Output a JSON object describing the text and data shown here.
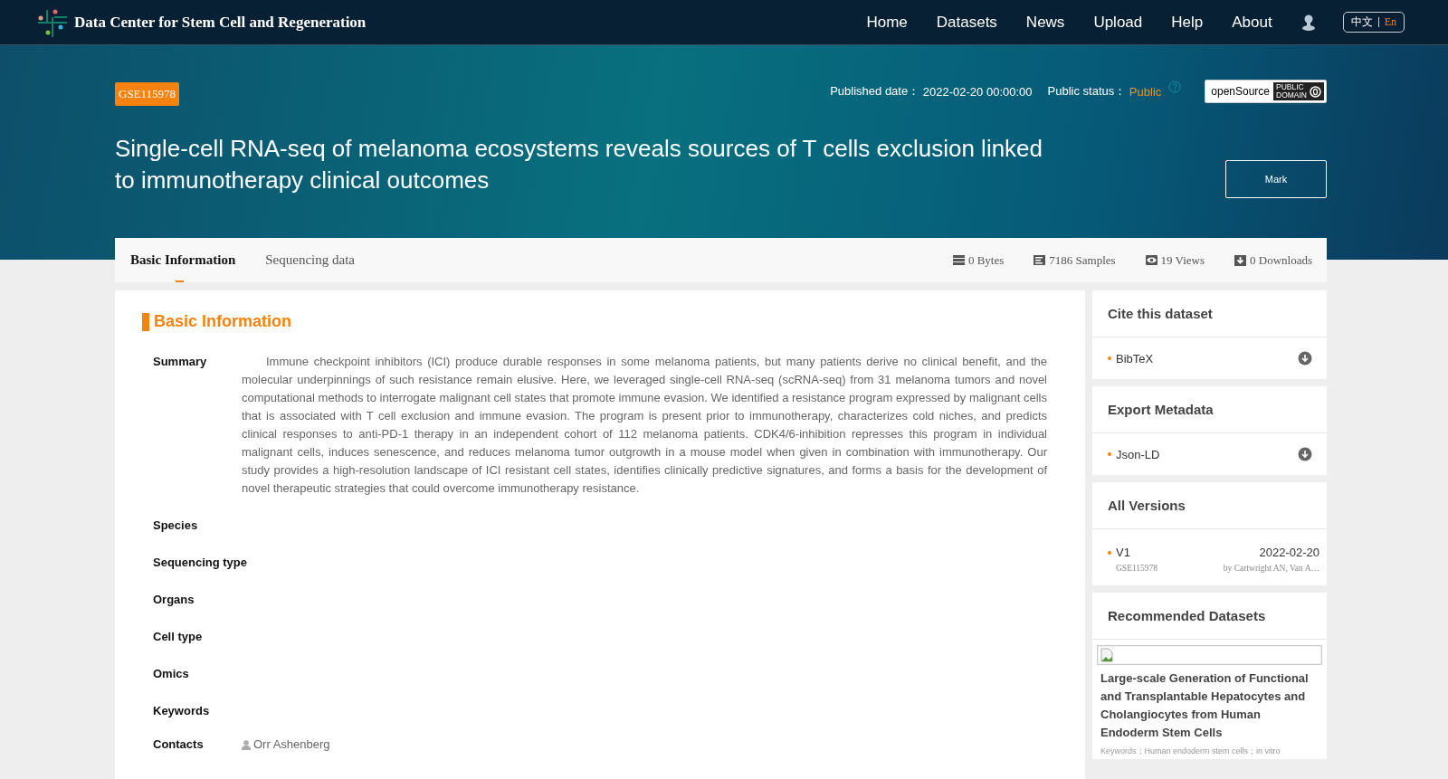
{
  "header": {
    "site_title": "Data Center for Stem Cell and Regeneration",
    "nav": [
      {
        "label": "Home"
      },
      {
        "label": "Datasets"
      },
      {
        "label": "News"
      },
      {
        "label": "Upload"
      },
      {
        "label": "Help"
      },
      {
        "label": "About"
      }
    ],
    "languages": [
      {
        "label": "中文",
        "selected": false
      },
      {
        "label": "En",
        "selected": true
      }
    ]
  },
  "dataset": {
    "accession": "GSE115978",
    "published_label": "Published date：",
    "published_date": "2022-02-20 00:00:00",
    "status_label": "Public status：",
    "status": "Public",
    "license_label": "openSource",
    "license_badge": [
      "PUBLIC",
      "DOMAIN"
    ],
    "title": "Single-cell RNA-seq of melanoma ecosystems reveals sources of T cells exclusion linked to immunotherapy clinical outcomes",
    "mark_button": "Mark"
  },
  "tabs": [
    {
      "label": "Basic Information",
      "selected": true
    },
    {
      "label": "Sequencing data",
      "selected": false
    }
  ],
  "stats": [
    {
      "kind": "size",
      "text": "0 Bytes"
    },
    {
      "kind": "samples",
      "text": "7186 Samples"
    },
    {
      "kind": "views",
      "text": "19 Views"
    },
    {
      "kind": "downloads",
      "text": "0 Downloads"
    }
  ],
  "basic_info": {
    "heading": "Basic Information",
    "fields": [
      {
        "label": "Summary",
        "kind": "text",
        "value": "Immune checkpoint inhibitors (ICI) produce durable responses in some melanoma patients, but many patients derive no clinical benefit, and the molecular underpinnings of such resistance remain elusive. Here, we leveraged single-cell RNA-seq (scRNA-seq) from 31 melanoma tumors and novel computational methods to interrogate malignant cell states that promote immune evasion. We identified a resistance program expressed by malignant cells that is associated with T cell exclusion and immune evasion. The program is present prior to immunotherapy, characterizes cold niches, and predicts clinical responses to anti-PD-1 therapy in an independent cohort of 112 melanoma patients. CDK4/6-inhibition represses this program in individual malignant cells, induces senescence, and reduces melanoma tumor outgrowth in a mouse model when given in combination with immunotherapy. Our study provides a high-resolution landscape of ICI resistant cell states, identifies clinically predictive signatures, and forms a basis for the development of novel therapeutic strategies that could overcome immunotherapy resistance."
      },
      {
        "label": "Species",
        "kind": "text"
      },
      {
        "label": "Sequencing type",
        "kind": "text"
      },
      {
        "label": "Organs",
        "kind": "text"
      },
      {
        "label": "Cell type",
        "kind": "text"
      },
      {
        "label": "Omics",
        "kind": "text"
      },
      {
        "label": "Keywords",
        "kind": "text"
      },
      {
        "label": "Contacts",
        "kind": "person",
        "value": "Orr Ashenberg"
      }
    ]
  },
  "sidebar": {
    "cite": {
      "title": "Cite this dataset",
      "items": [
        {
          "label": "BibTeX"
        }
      ]
    },
    "export": {
      "title": "Export Metadata",
      "items": [
        {
          "label": "Json-LD"
        }
      ]
    },
    "versions": {
      "title": "All Versions",
      "items": [
        {
          "version": "V1",
          "date": "2022-02-20",
          "accession": "GSE115978",
          "authors": "by Cartwright AN, Van A…"
        }
      ]
    },
    "recommended": {
      "title": "Recommended Datasets",
      "items": [
        {
          "title": "Large-scale Generation of Functional and Transplantable Hepatocytes and Cholangiocytes from Human Endoderm Stem Cells",
          "keywords": "Keywords：Human endoderm stem cells；in vitro"
        }
      ]
    }
  }
}
